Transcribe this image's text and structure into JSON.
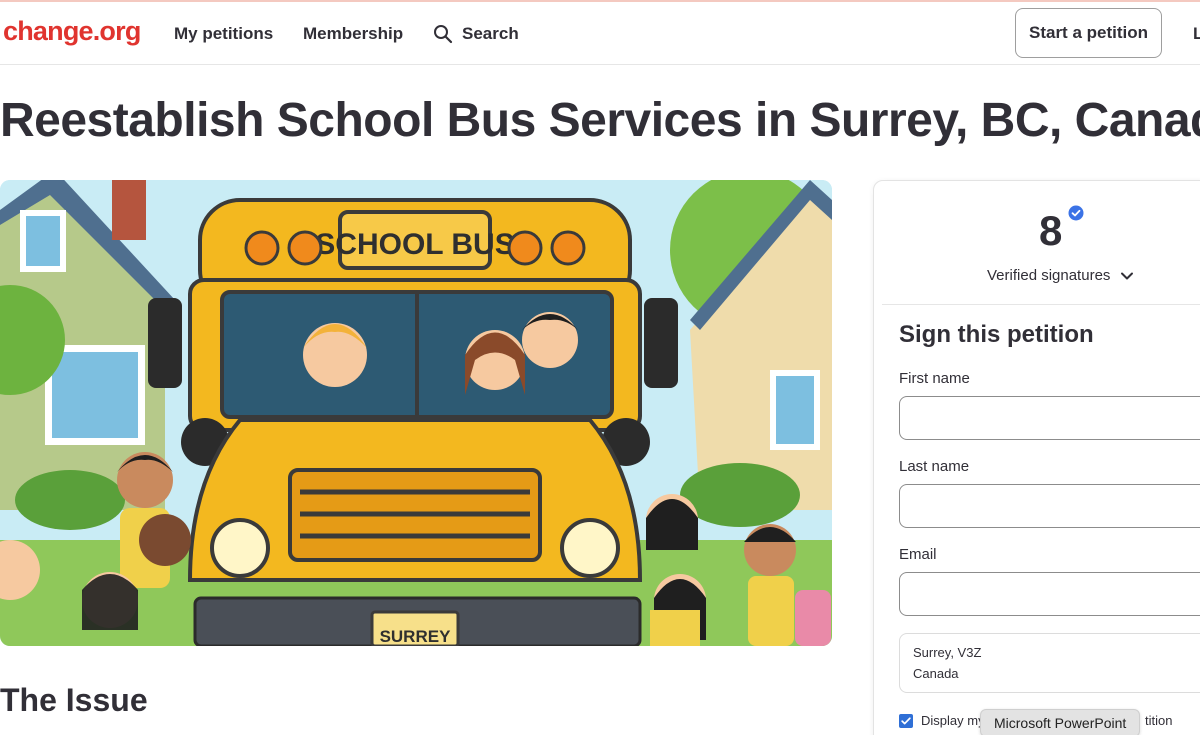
{
  "brand": {
    "logo": "change.org",
    "accent": "#e0342f"
  },
  "nav": {
    "my_petitions": "My petitions",
    "membership": "Membership",
    "search": "Search",
    "search_icon": "search-icon",
    "start_petition": "Start a petition",
    "cut_item": "L"
  },
  "petition": {
    "title": "Reestablish School Bus Services in Surrey, BC, Canada",
    "image": {
      "sign_text": "SCHOOL BUS",
      "plate_text": "SURREY"
    },
    "issue_heading": "The Issue"
  },
  "signatures": {
    "count": "8",
    "verified_label": "Verified signatures",
    "verified_icon": "verified-badge-icon",
    "accent": "#3b73e6"
  },
  "form": {
    "heading": "Sign this petition",
    "first_name_label": "First name",
    "first_name_value": "",
    "last_name_label": "Last name",
    "last_name_value": "",
    "email_label": "Email",
    "email_value": "",
    "location_line1": "Surrey, V3Z",
    "location_line2": "Canada",
    "consent_label_start": "Display my",
    "consent_label_end": "tition",
    "consent_checked": true
  },
  "os_tooltip": "Microsoft PowerPoint"
}
